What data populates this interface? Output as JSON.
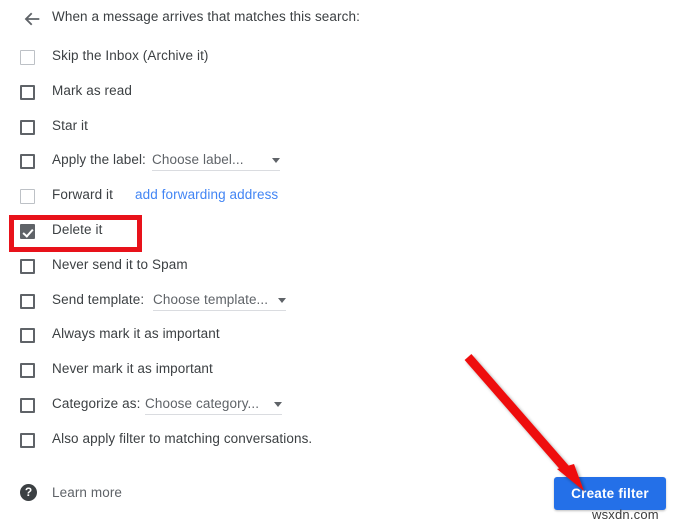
{
  "header": {
    "back_icon": "back-arrow-icon",
    "title": "When a message arrives that matches this search:"
  },
  "rows": [
    {
      "label": "Skip the Inbox (Archive it)",
      "checked": false,
      "dim": true
    },
    {
      "label": "Mark as read",
      "checked": false,
      "dim": false
    },
    {
      "label": "Star it",
      "checked": false,
      "dim": false
    },
    {
      "label": "Apply the label:",
      "checked": false,
      "dim": false,
      "dropdown": "Choose label..."
    },
    {
      "label": "Forward it",
      "checked": false,
      "dim": true,
      "link": "add forwarding address"
    },
    {
      "label": "Delete it",
      "checked": true,
      "dim": false,
      "highlighted": true
    },
    {
      "label": "Never send it to Spam",
      "checked": false,
      "dim": false
    },
    {
      "label": "Send template:",
      "checked": false,
      "dim": false,
      "dropdown": "Choose template..."
    },
    {
      "label": "Always mark it as important",
      "checked": false,
      "dim": false
    },
    {
      "label": "Never mark it as important",
      "checked": false,
      "dim": false
    },
    {
      "label": "Categorize as:",
      "checked": false,
      "dim": false,
      "dropdown": "Choose category..."
    },
    {
      "label": "Also apply filter to matching conversations.",
      "checked": false,
      "dim": false
    }
  ],
  "footer": {
    "help_icon": "help-question-icon",
    "learn_more_label": "Learn more",
    "create_filter_label": "Create filter"
  },
  "annotations": {
    "highlight_color": "#e8121a",
    "arrow_color": "#ee1111",
    "arrow_name": "red-pointer-arrow"
  },
  "watermark": "wsxdn.com",
  "colors": {
    "accent_button": "#2470e8",
    "link": "#4285f4",
    "text": "#3c4043",
    "muted_text": "#5f6368",
    "checkbox_border": "#5f6368",
    "checkbox_dim_border": "#bdc1c6"
  }
}
